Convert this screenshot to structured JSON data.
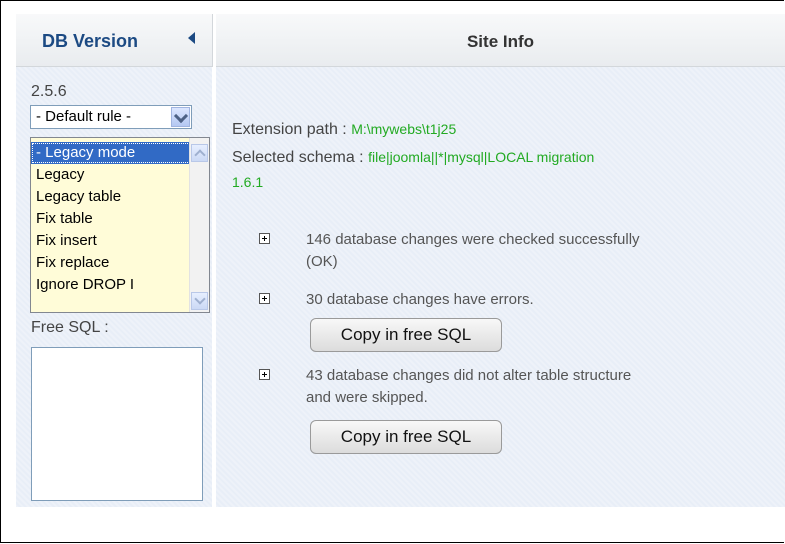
{
  "header": {
    "left_title": "DB Version",
    "right_title": "Site Info"
  },
  "sidebar": {
    "version": "2.5.6",
    "rule_select": {
      "selected": "- Default rule -"
    },
    "rules_list": [
      "- Legacy mode",
      "Legacy",
      "Legacy table",
      "Fix table",
      "Fix insert",
      "Fix replace",
      "Ignore DROP I"
    ],
    "selected_rule_index": 0,
    "free_sql_label": "Free SQL :",
    "free_sql_value": ""
  },
  "site_info": {
    "extension_path_label": "Extension path :",
    "extension_path_value": "M:\\mywebs\\t1j25",
    "selected_schema_label": "Selected schema :",
    "selected_schema_value": "file|joomla||*|mysql|LOCAL migration",
    "selected_schema_value_cont": "1.6.1",
    "results": [
      {
        "line1": "146 database changes were checked successfully",
        "line2": "(OK)"
      },
      {
        "line1": "30 database changes have errors.",
        "button": "Copy in free SQL"
      },
      {
        "line1": "43 database changes did not alter table structure",
        "line2": "and were skipped.",
        "button": "Copy in free SQL"
      }
    ]
  },
  "colors": {
    "header_title": "#1c4a83",
    "schema_value": "#22aa22",
    "panel_bg": "#e8eef7",
    "selection": "#316ac5"
  }
}
